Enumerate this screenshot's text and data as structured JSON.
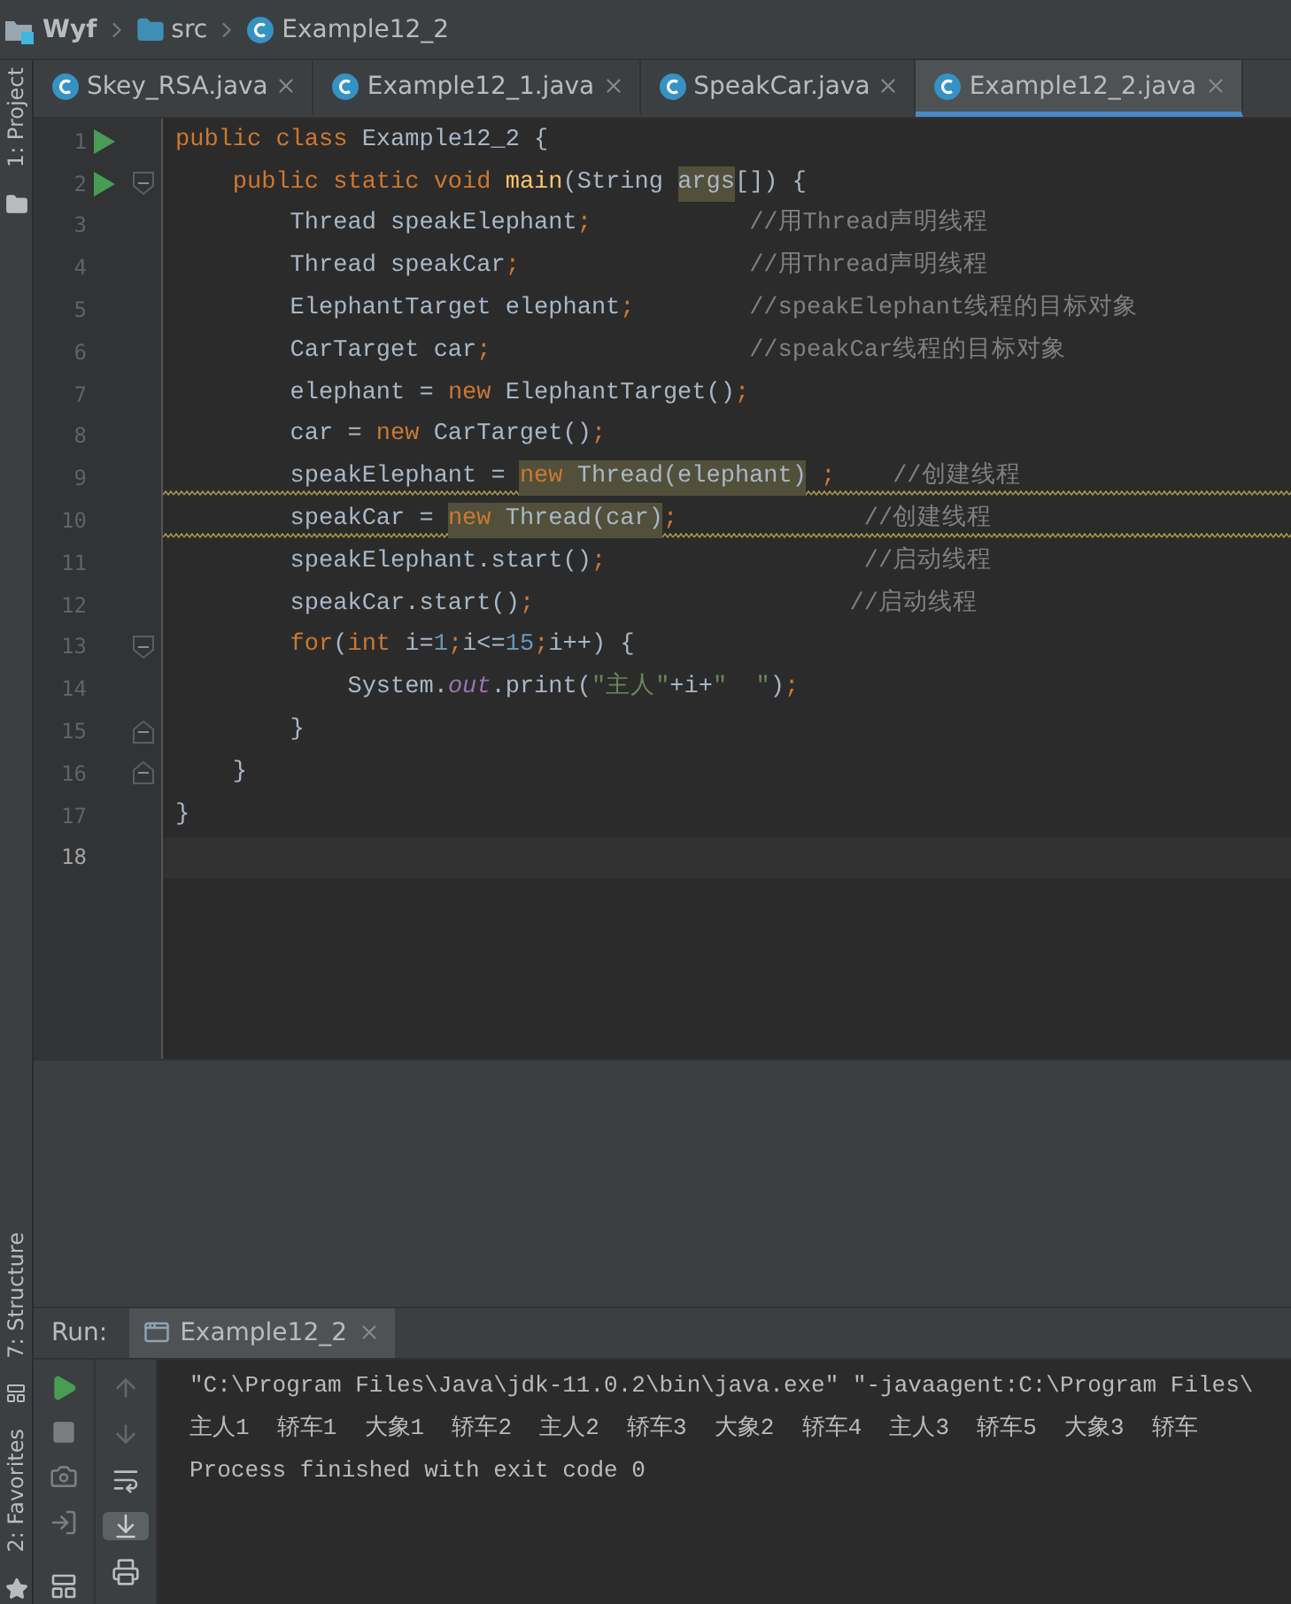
{
  "breadcrumb": [
    {
      "label": "Wyf",
      "kind": "module"
    },
    {
      "label": "src",
      "kind": "folder"
    },
    {
      "label": "Example12_2",
      "kind": "class"
    }
  ],
  "side_tools_top": [
    {
      "label": "1: Project"
    }
  ],
  "side_tools_bottom": [
    {
      "label": "7: Structure"
    },
    {
      "label": "2: Favorites"
    }
  ],
  "tabs": [
    {
      "label": "Skey_RSA.java",
      "selected": false
    },
    {
      "label": "Example12_1.java",
      "selected": false
    },
    {
      "label": "SpeakCar.java",
      "selected": false
    },
    {
      "label": "Example12_2.java",
      "selected": true
    }
  ],
  "code": [
    {
      "number": "1",
      "run_marker": true,
      "warning": false,
      "current": false,
      "segments": [
        {
          "kind": "keyword",
          "text": "public class "
        },
        {
          "kind": "text",
          "text": "Example12_2 {"
        }
      ]
    },
    {
      "number": "2",
      "run_marker": true,
      "fold_open": true,
      "warning": false,
      "current": false,
      "segments": [
        {
          "kind": "keyword",
          "text": "    public static void "
        },
        {
          "kind": "method",
          "text": "main"
        },
        {
          "kind": "text",
          "text": "(String "
        },
        {
          "kind": "text",
          "text": "args",
          "highlighted": true
        },
        {
          "kind": "text",
          "text": "[]) {"
        }
      ]
    },
    {
      "number": "3",
      "warning": false,
      "current": false,
      "segments": [
        {
          "kind": "text",
          "text": "        Thread speakElephant"
        },
        {
          "kind": "punct",
          "text": ";           "
        },
        {
          "kind": "comment",
          "text": "//用Thread声明线程"
        }
      ]
    },
    {
      "number": "4",
      "warning": false,
      "current": false,
      "segments": [
        {
          "kind": "text",
          "text": "        Thread speakCar"
        },
        {
          "kind": "punct",
          "text": ";                "
        },
        {
          "kind": "comment",
          "text": "//用Thread声明线程"
        }
      ]
    },
    {
      "number": "5",
      "warning": false,
      "current": false,
      "segments": [
        {
          "kind": "text",
          "text": "        ElephantTarget elephant"
        },
        {
          "kind": "punct",
          "text": ";        "
        },
        {
          "kind": "comment",
          "text": "//speakElephant线程的目标对象"
        }
      ]
    },
    {
      "number": "6",
      "warning": false,
      "current": false,
      "segments": [
        {
          "kind": "text",
          "text": "        CarTarget car"
        },
        {
          "kind": "punct",
          "text": ";                  "
        },
        {
          "kind": "comment",
          "text": "//speakCar线程的目标对象"
        }
      ]
    },
    {
      "number": "7",
      "warning": false,
      "current": false,
      "segments": [
        {
          "kind": "text",
          "text": "        elephant = "
        },
        {
          "kind": "keyword",
          "text": "new "
        },
        {
          "kind": "text",
          "text": "ElephantTarget()"
        },
        {
          "kind": "punct",
          "text": ";"
        }
      ]
    },
    {
      "number": "8",
      "warning": false,
      "current": false,
      "segments": [
        {
          "kind": "text",
          "text": "        car = "
        },
        {
          "kind": "keyword",
          "text": "new "
        },
        {
          "kind": "text",
          "text": "CarTarget()"
        },
        {
          "kind": "punct",
          "text": ";"
        }
      ]
    },
    {
      "number": "9",
      "warning": true,
      "current": false,
      "segments": [
        {
          "kind": "text",
          "text": "        speakElephant = "
        },
        {
          "kind": "keyword",
          "text": "new ",
          "highlighted": true
        },
        {
          "kind": "text",
          "text": "Thread(elephant)",
          "highlighted": true
        },
        {
          "kind": "punct",
          "text": " ;    "
        },
        {
          "kind": "comment",
          "text": "//创建线程"
        }
      ]
    },
    {
      "number": "10",
      "warning": true,
      "current": false,
      "segments": [
        {
          "kind": "text",
          "text": "        speakCar = "
        },
        {
          "kind": "keyword",
          "text": "new ",
          "highlighted": true
        },
        {
          "kind": "text",
          "text": "Thread(car)",
          "highlighted": true
        },
        {
          "kind": "punct",
          "text": ";             "
        },
        {
          "kind": "comment",
          "text": "//创建线程"
        }
      ]
    },
    {
      "number": "11",
      "warning": false,
      "current": false,
      "segments": [
        {
          "kind": "text",
          "text": "        speakElephant.start()"
        },
        {
          "kind": "punct",
          "text": ";                  "
        },
        {
          "kind": "comment",
          "text": "//启动线程"
        }
      ]
    },
    {
      "number": "12",
      "warning": false,
      "current": false,
      "segments": [
        {
          "kind": "text",
          "text": "        speakCar.start()"
        },
        {
          "kind": "punct",
          "text": ";                      "
        },
        {
          "kind": "comment",
          "text": "//启动线程"
        }
      ]
    },
    {
      "number": "13",
      "fold_open": true,
      "warning": false,
      "current": false,
      "segments": [
        {
          "kind": "keyword",
          "text": "        for"
        },
        {
          "kind": "text",
          "text": "("
        },
        {
          "kind": "keyword",
          "text": "int "
        },
        {
          "kind": "text",
          "text": "i="
        },
        {
          "kind": "number",
          "text": "1"
        },
        {
          "kind": "punct",
          "text": ";"
        },
        {
          "kind": "text",
          "text": "i<="
        },
        {
          "kind": "number",
          "text": "15"
        },
        {
          "kind": "punct",
          "text": ";"
        },
        {
          "kind": "text",
          "text": "i++) {"
        }
      ]
    },
    {
      "number": "14",
      "warning": false,
      "current": false,
      "segments": [
        {
          "kind": "text",
          "text": "            System."
        },
        {
          "kind": "field",
          "text": "out"
        },
        {
          "kind": "text",
          "text": ".print("
        },
        {
          "kind": "string",
          "text": "\"主人\""
        },
        {
          "kind": "text",
          "text": "+i+"
        },
        {
          "kind": "string",
          "text": "\"  \""
        },
        {
          "kind": "text",
          "text": ")"
        },
        {
          "kind": "punct",
          "text": ";"
        }
      ]
    },
    {
      "number": "15",
      "fold_close": true,
      "warning": false,
      "current": false,
      "segments": [
        {
          "kind": "text",
          "text": "        }"
        }
      ]
    },
    {
      "number": "16",
      "fold_close": true,
      "warning": false,
      "current": false,
      "segments": [
        {
          "kind": "text",
          "text": "    }"
        }
      ]
    },
    {
      "number": "17",
      "warning": false,
      "current": false,
      "segments": [
        {
          "kind": "text",
          "text": "}"
        }
      ]
    },
    {
      "number": "18",
      "warning": false,
      "current": true
    }
  ],
  "run_panel": {
    "label": "Run:",
    "tab": "Example12_2",
    "output": [
      "\"C:\\Program Files\\Java\\jdk-11.0.2\\bin\\java.exe\" \"-javaagent:C:\\Program Files\\",
      "主人1  轿车1  大象1  轿车2  主人2  轿车3  大象2  轿车4  主人3  轿车5  大象3  轿车",
      "Process finished with exit code 0"
    ]
  }
}
